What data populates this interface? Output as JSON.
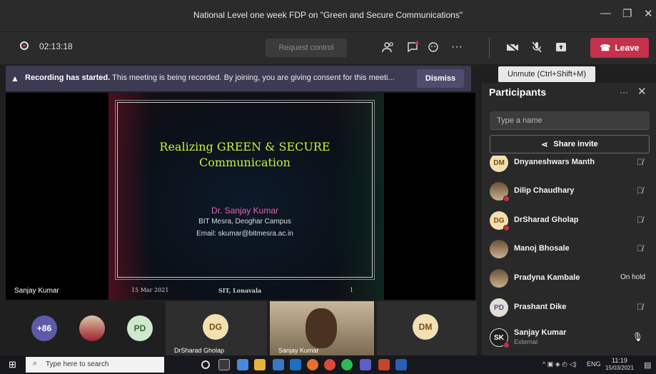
{
  "window": {
    "title": "National Level one week FDP on \"Green and Secure Communications\"",
    "minimize_icon": "minimize-icon",
    "maximize_icon": "maximize-icon",
    "close_icon": "close-icon"
  },
  "toolbar": {
    "timer": "02:13:18",
    "request_control": "Request control",
    "leave": "Leave",
    "accent": "#c4314b"
  },
  "banner": {
    "strong": "Recording has started.",
    "text": " This meeting is being recorded. By joining, you are giving consent for this meeti...",
    "dismiss": "Dismiss"
  },
  "tooltip": "Unmute (Ctrl+Shift+M)",
  "slide": {
    "title_line1": "Realizing GREEN & SECURE",
    "title_line2": "Communication",
    "presenter": "Dr. Sanjay Kumar",
    "affiliation": "BIT Mesra, Deoghar Campus",
    "email": "Email: skumar@bitmesra.ac.in",
    "date": "15 Mar 2021",
    "venue": "SIT, Lonavala",
    "page": "1"
  },
  "speaker_label": "Sanjay Kumar",
  "panel": {
    "title": "Participants",
    "search_placeholder": "Type a name",
    "share_invite": "Share invite"
  },
  "participants": [
    {
      "name": "Dnyaneshwars Manth",
      "initials": "DM",
      "state": ""
    },
    {
      "name": "Dilip Chaudhary",
      "initials": "",
      "state": ""
    },
    {
      "name": "DrSharad Gholap",
      "initials": "DG",
      "state": ""
    },
    {
      "name": "Manoj Bhosale",
      "initials": "",
      "state": ""
    },
    {
      "name": "Pradyna Kambale",
      "initials": "",
      "state": "On hold"
    },
    {
      "name": "Prashant Dike",
      "initials": "PD",
      "state": ""
    },
    {
      "name": "Sanjay Kumar",
      "initials": "SK",
      "state": "",
      "sub": "External"
    }
  ],
  "strip": {
    "overflow": "+86",
    "pd": "PD",
    "dg": "DG",
    "dg_label": "DrSharad Gholap",
    "video_label": "Sanjay Kumar",
    "dm": "DM"
  },
  "taskbar": {
    "search": "Type here to search",
    "lang": "ENG",
    "time": "11:19",
    "date": "15/03/2021"
  }
}
